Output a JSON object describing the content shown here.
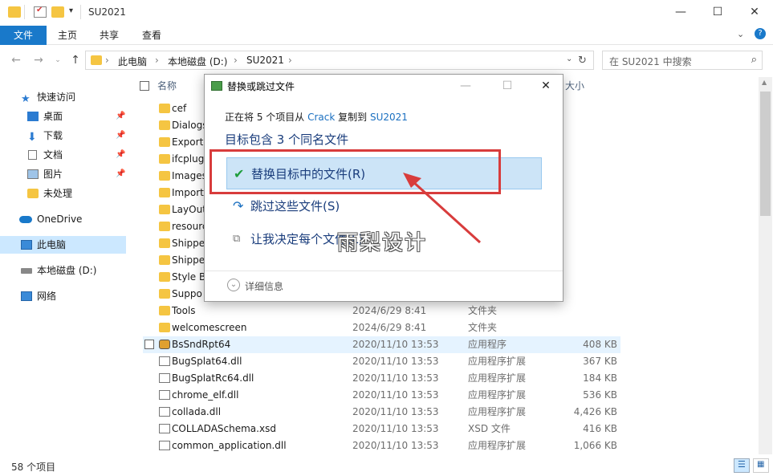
{
  "window": {
    "title": "SU2021",
    "minimize": "—",
    "maximize": "☐",
    "close": "✕"
  },
  "ribbon": {
    "tabs": [
      "文件",
      "主页",
      "共享",
      "查看"
    ]
  },
  "address": {
    "crumbs": [
      "此电脑",
      "本地磁盘 (D:)",
      "SU2021"
    ],
    "search_placeholder": "在 SU2021 中搜索"
  },
  "sidebar": {
    "items": [
      {
        "label": "快速访问",
        "icon": "star-icon",
        "pinned": false
      },
      {
        "label": "桌面",
        "icon": "desktop-icon",
        "pinned": true
      },
      {
        "label": "下载",
        "icon": "download-icon",
        "pinned": true
      },
      {
        "label": "文档",
        "icon": "document-icon",
        "pinned": true
      },
      {
        "label": "图片",
        "icon": "picture-icon",
        "pinned": true
      },
      {
        "label": "未处理",
        "icon": "folder-icon",
        "pinned": false
      },
      {
        "label": "OneDrive",
        "icon": "cloud-icon",
        "pinned": false
      },
      {
        "label": "此电脑",
        "icon": "computer-icon",
        "pinned": false
      },
      {
        "label": "本地磁盘 (D:)",
        "icon": "drive-icon",
        "pinned": false
      },
      {
        "label": "网络",
        "icon": "network-icon",
        "pinned": false
      }
    ]
  },
  "filelist": {
    "columns": {
      "name": "名称",
      "size": "大小"
    },
    "rows": [
      {
        "name": "cef",
        "date": "",
        "type": "",
        "size": "",
        "icon": "folder-icon"
      },
      {
        "name": "Dialogs",
        "date": "",
        "type": "",
        "size": "",
        "icon": "folder-icon"
      },
      {
        "name": "Exporters",
        "date": "",
        "type": "",
        "size": "",
        "icon": "folder-icon"
      },
      {
        "name": "ifcplugins",
        "date": "",
        "type": "",
        "size": "",
        "icon": "folder-icon"
      },
      {
        "name": "Images",
        "date": "",
        "type": "",
        "size": "",
        "icon": "folder-icon"
      },
      {
        "name": "Importers",
        "date": "",
        "type": "",
        "size": "",
        "icon": "folder-icon"
      },
      {
        "name": "LayOut",
        "date": "",
        "type": "",
        "size": "",
        "icon": "folder-icon"
      },
      {
        "name": "resources",
        "date": "",
        "type": "",
        "size": "",
        "icon": "folder-icon"
      },
      {
        "name": "Shippe",
        "date": "",
        "type": "",
        "size": "",
        "icon": "folder-icon"
      },
      {
        "name": "Shippe",
        "date": "",
        "type": "",
        "size": "",
        "icon": "folder-icon"
      },
      {
        "name": "Style B",
        "date": "",
        "type": "",
        "size": "",
        "icon": "folder-icon"
      },
      {
        "name": "Suppo",
        "date": "",
        "type": "",
        "size": "",
        "icon": "folder-icon"
      },
      {
        "name": "Tools",
        "date": "2024/6/29 8:41",
        "type": "文件夹",
        "size": "",
        "icon": "folder-icon"
      },
      {
        "name": "welcomescreen",
        "date": "2024/6/29 8:41",
        "type": "文件夹",
        "size": "",
        "icon": "folder-icon"
      },
      {
        "name": "BsSndRpt64",
        "date": "2020/11/10 13:53",
        "type": "应用程序",
        "size": "408 KB",
        "icon": "app-icon"
      },
      {
        "name": "BugSplat64.dll",
        "date": "2020/11/10 13:53",
        "type": "应用程序扩展",
        "size": "367 KB",
        "icon": "dll-icon"
      },
      {
        "name": "BugSplatRc64.dll",
        "date": "2020/11/10 13:53",
        "type": "应用程序扩展",
        "size": "184 KB",
        "icon": "dll-icon"
      },
      {
        "name": "chrome_elf.dll",
        "date": "2020/11/10 13:53",
        "type": "应用程序扩展",
        "size": "536 KB",
        "icon": "dll-icon"
      },
      {
        "name": "collada.dll",
        "date": "2020/11/10 13:53",
        "type": "应用程序扩展",
        "size": "4,426 KB",
        "icon": "dll-icon"
      },
      {
        "name": "COLLADASchema.xsd",
        "date": "2020/11/10 13:53",
        "type": "XSD 文件",
        "size": "416 KB",
        "icon": "file-icon"
      },
      {
        "name": "common_application.dll",
        "date": "2020/11/10 13:53",
        "type": "应用程序扩展",
        "size": "1,066 KB",
        "icon": "dll-icon"
      }
    ]
  },
  "status": {
    "count": "58 个项目"
  },
  "dialog": {
    "title": "替换或跳过文件",
    "progress_prefix": "正在将 5 个项目从",
    "source": "Crack",
    "progress_mid": "复制到",
    "dest": "SU2021",
    "heading": "目标包含 3 个同名文件",
    "options": [
      {
        "label": "替换目标中的文件(R)",
        "icon": "✔"
      },
      {
        "label": "跳过这些文件(S)",
        "icon": "↷"
      },
      {
        "label": "让我决定每个文件(L)",
        "icon": "⧉"
      }
    ],
    "details": "详细信息"
  },
  "watermark": "雨梨设计",
  "colors": {
    "accent": "#1979ca",
    "annotation": "#d83c3c",
    "selected": "#cce4f7"
  }
}
